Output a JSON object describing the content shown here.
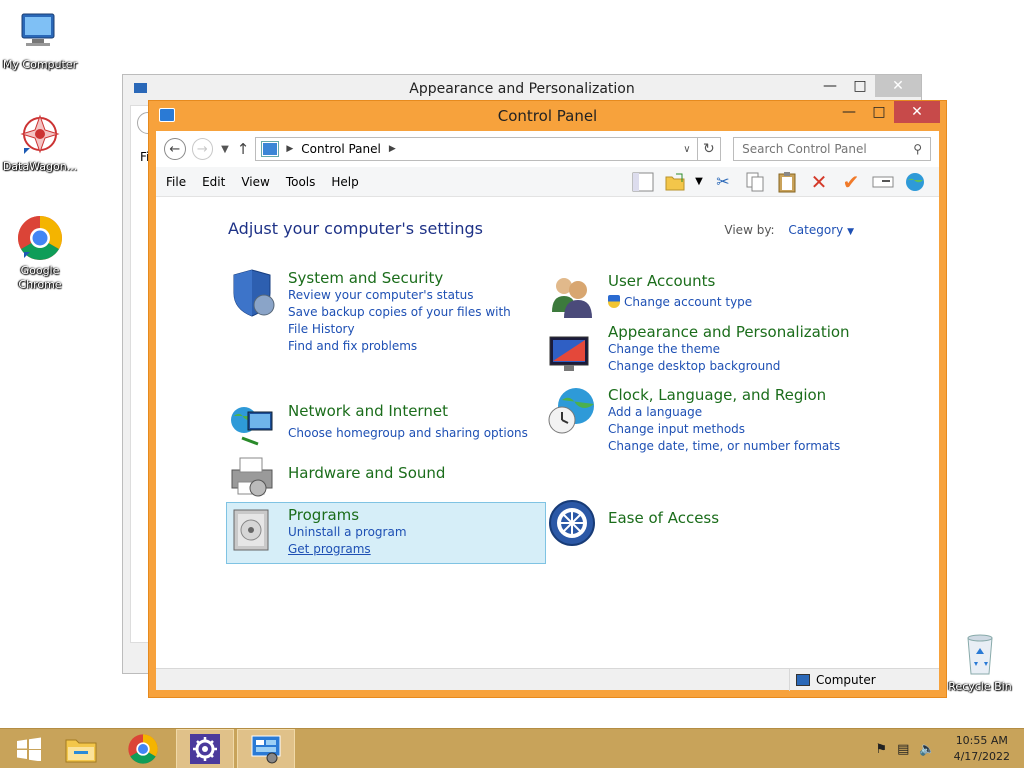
{
  "desktop": {
    "icons": [
      {
        "label": "My Computer"
      },
      {
        "label": "DataWagon..."
      },
      {
        "label": "Google Chrome"
      },
      {
        "label": "Recycle Bin"
      }
    ]
  },
  "background_window": {
    "title": "Appearance and Personalization",
    "fragment_text": "Fi"
  },
  "window": {
    "title": "Control Panel",
    "breadcrumb": [
      "Control Panel"
    ],
    "search": {
      "placeholder": "Search Control Panel"
    },
    "menu": [
      "File",
      "Edit",
      "View",
      "Tools",
      "Help"
    ],
    "heading": "Adjust your computer's settings",
    "view_by": {
      "label": "View by:",
      "value": "Category"
    },
    "categories_left": [
      {
        "title": "System and Security",
        "links": [
          "Review your computer's status",
          "Save backup copies of your files with File History",
          "Find and fix problems"
        ],
        "icon": "shield-icon"
      },
      {
        "title": "Network and Internet",
        "links": [
          "Choose homegroup and sharing options"
        ],
        "icon": "network-icon"
      },
      {
        "title": "Hardware and Sound",
        "links": [],
        "icon": "printer-icon"
      },
      {
        "title": "Programs",
        "links": [
          "Uninstall a program",
          "Get programs"
        ],
        "icon": "programs-icon"
      }
    ],
    "categories_right": [
      {
        "title": "User Accounts",
        "links": [
          "Change account type"
        ],
        "icon": "users-icon"
      },
      {
        "title": "Appearance and Personalization",
        "links": [
          "Change the theme",
          "Change desktop background"
        ],
        "icon": "display-icon"
      },
      {
        "title": "Clock, Language, and Region",
        "links": [
          "Add a language",
          "Change input methods",
          "Change date, time, or number formats"
        ],
        "icon": "globe-clock-icon"
      },
      {
        "title": "Ease of Access",
        "links": [],
        "icon": "ease-of-access-icon"
      }
    ],
    "status": "Computer"
  },
  "taskbar": {
    "time": "10:55 AM",
    "date": "4/17/2022"
  },
  "colors": {
    "window_frame": "#f7a23c",
    "category_title": "#1b6d1b",
    "link": "#1e50b4",
    "heading": "#1e3287",
    "taskbar": "#c8a35a"
  }
}
